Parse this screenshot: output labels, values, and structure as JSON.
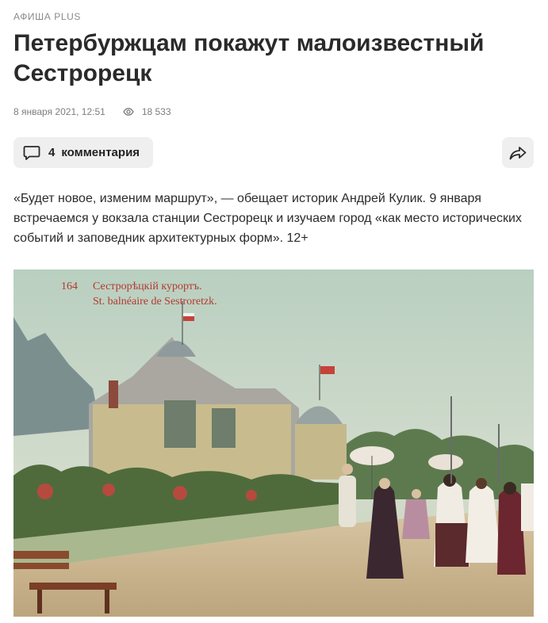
{
  "article": {
    "kicker": "Афиша Plus",
    "title": "Петербуржцам покажут малоизвестный Сестрорецк",
    "date": "8 января 2021, 12:51",
    "views": "18 533",
    "comments_count": "4",
    "comments_label": "комментария",
    "lead": "«Будет новое, изменим маршрут», — обещает историк Андрей Кулик. 9 января встречаемся у вокзала станции Сестрорецк и изучаем город «как место исторических событий и заповедник архитектурных форм». 12+"
  },
  "image": {
    "caption_number": "164",
    "caption_ru": "Сестрорѣцкій курортъ.",
    "caption_fr": "St. balnéaire de Sestroretzk."
  },
  "icons": {
    "views": "eye-icon",
    "comments": "comment-icon",
    "share": "share-icon"
  }
}
